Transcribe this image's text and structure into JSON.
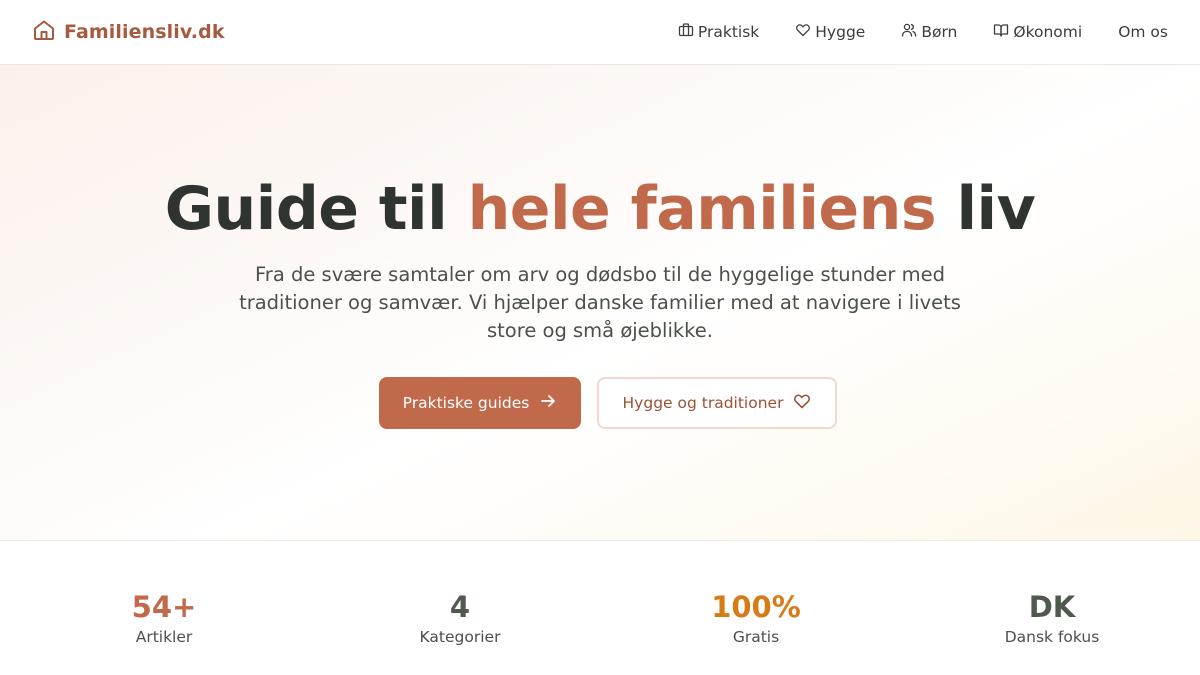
{
  "header": {
    "logo_text": "Familiensliv.dk",
    "logo_icon": "home-icon",
    "nav": [
      {
        "label": "Praktisk",
        "icon": "briefcase-icon"
      },
      {
        "label": "Hygge",
        "icon": "heart-icon"
      },
      {
        "label": "Børn",
        "icon": "users-icon"
      },
      {
        "label": "Økonomi",
        "icon": "book-icon"
      },
      {
        "label": "Om os",
        "icon": ""
      }
    ]
  },
  "hero": {
    "title_part1": "Guide til ",
    "title_accent": "hele familiens",
    "title_part2": " liv",
    "subtitle": "Fra de svære samtaler om arv og dødsbo til de hyggelige stunder med traditioner og samvær. Vi hjælper danske familier med at navigere i livets store og små øjeblikke.",
    "primary_button": "Praktiske guides",
    "secondary_button": "Hygge og traditioner"
  },
  "stats": [
    {
      "value": "54+",
      "label": "Artikler",
      "color": "#c0694b"
    },
    {
      "value": "4",
      "label": "Kategorier",
      "color": "#4d5a4c"
    },
    {
      "value": "100%",
      "label": "Gratis",
      "color": "#d67b16"
    },
    {
      "value": "DK",
      "label": "Dansk fokus",
      "color": "#4d5a4c"
    }
  ],
  "colors": {
    "brand": "#a65a3f",
    "accent": "#c0694b",
    "text": "#2f3430"
  }
}
